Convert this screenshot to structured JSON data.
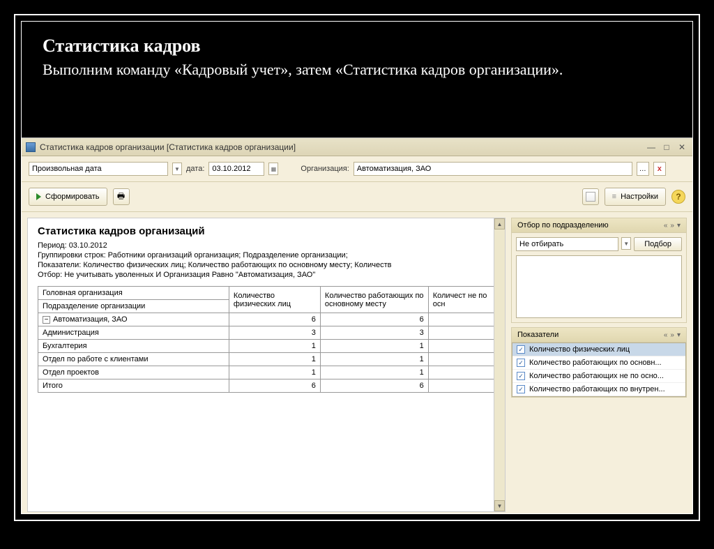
{
  "slide": {
    "title": "Статистика кадров",
    "subtitle": "Выполним команду «Кадровый учет», затем «Статистика кадров организации»."
  },
  "window": {
    "title": "Статистика кадров организации [Статистика кадров организации]"
  },
  "filters": {
    "period_type": "Произвольная дата",
    "date_label": "дата:",
    "date_value": "03.10.2012",
    "org_label": "Организация:",
    "org_value": "Автоматизация, ЗАО"
  },
  "toolbar": {
    "form_label": "Сформировать",
    "settings_label": "Настройки"
  },
  "report": {
    "title": "Статистика кадров организаций",
    "period": "Период: 03.10.2012",
    "groupings": "Группировки строк: Работники организаций организация; Подразделение организации;",
    "indicators": "Показатели: Количество физических лиц; Количество работающих по основному месту; Количеств",
    "filter": "Отбор: Не учитывать уволенных И Организация Равно \"Автоматизация, ЗАО\"",
    "headers": {
      "h1a": "Головная организация",
      "h1b": "Подразделение организации",
      "h2": "Количество физических лиц",
      "h3": "Количество работающих по основному месту",
      "h4": "Количест не по осн"
    },
    "rows": [
      {
        "name": "Автоматизация, ЗАО",
        "v1": "6",
        "v2": "6",
        "top": true
      },
      {
        "name": "Администрация",
        "v1": "3",
        "v2": "3"
      },
      {
        "name": "Бухгалтерия",
        "v1": "1",
        "v2": "1"
      },
      {
        "name": "Отдел по работе с клиентами",
        "v1": "1",
        "v2": "1"
      },
      {
        "name": "Отдел проектов",
        "v1": "1",
        "v2": "1"
      }
    ],
    "total": {
      "name": "Итого",
      "v1": "6",
      "v2": "6"
    }
  },
  "side": {
    "filter_panel": {
      "title": "Отбор по подразделению",
      "combo": "Не отбирать",
      "button": "Подбор"
    },
    "indicators_panel": {
      "title": "Показатели",
      "items": [
        "Количество физических лиц",
        "Количество работающих по основн...",
        "Количество работающих не по осно...",
        "Количество работающих по внутрен..."
      ]
    }
  }
}
